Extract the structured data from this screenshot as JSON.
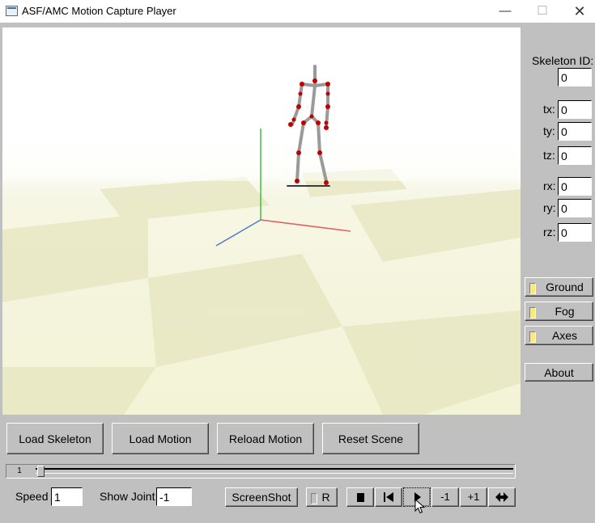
{
  "window": {
    "title": "ASF/AMC Motion Capture Player",
    "min_glyph": "—",
    "max_glyph": "☐",
    "close_glyph": "✕"
  },
  "sidebar": {
    "skeleton_id": {
      "label": "Skeleton ID:",
      "value": "0"
    },
    "translation": [
      {
        "label": "tx:",
        "value": "0"
      },
      {
        "label": "ty:",
        "value": "0"
      },
      {
        "label": "tz:",
        "value": "0"
      }
    ],
    "rotation": [
      {
        "label": "rx:",
        "value": "0"
      },
      {
        "label": "ry:",
        "value": "0"
      },
      {
        "label": "rz:",
        "value": "0"
      }
    ],
    "toggles": [
      {
        "label": "Ground",
        "checked": true
      },
      {
        "label": "Fog",
        "checked": true
      },
      {
        "label": "Axes",
        "checked": true
      }
    ],
    "about_label": "About"
  },
  "scene_buttons": {
    "load_skeleton": "Load Skeleton",
    "load_motion": "Load Motion",
    "reload_motion": "Reload Motion",
    "reset_scene": "Reset Scene"
  },
  "frame_slider": {
    "frame": "1",
    "position": 0.0
  },
  "controls": {
    "speed_label": "Speed",
    "speed_value": "1",
    "show_joint_label": "Show Joint",
    "show_joint_value": "-1",
    "screenshot_label": "ScreenShot",
    "record_label": "R",
    "step_back_label": "-1",
    "step_forward_label": "+1"
  },
  "colors": {
    "ground_light": "#f5f5dc",
    "ground_dark": "#e8e8c4",
    "axis_x": "#e06060",
    "axis_y": "#40c040",
    "axis_z": "#4a7ad0",
    "joint": "#c00000",
    "bone": "#9a9a9a"
  }
}
